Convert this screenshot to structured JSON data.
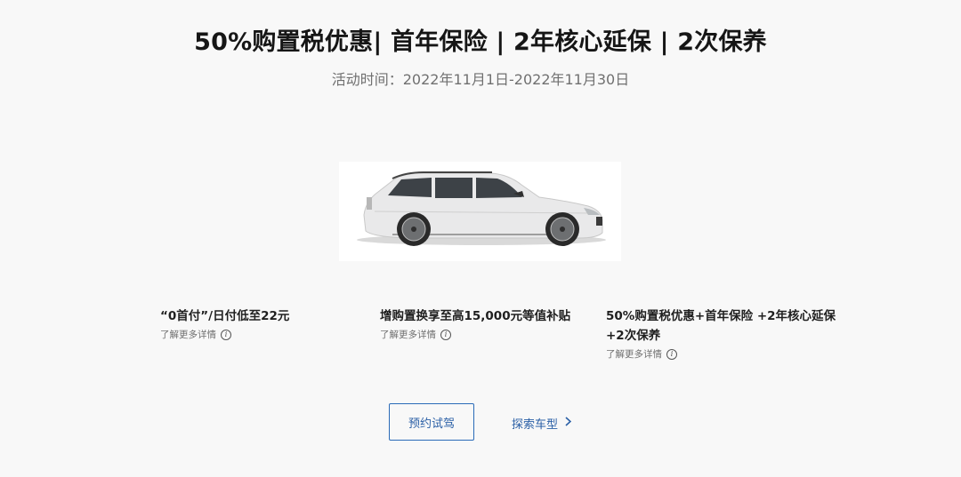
{
  "header": {
    "headline": "50%购置税优惠| 首年保险 | 2年核心延保 | 2次保养",
    "period": "活动时间：2022年11月1日-2022年11月30日"
  },
  "hero": {
    "image": "car-photo"
  },
  "features": [
    {
      "title": "“0首付”/日付低至22元",
      "more": "了解更多详情",
      "icon": "info-icon"
    },
    {
      "title": "增购置换享至高15,000元等值补贴",
      "more": "了解更多详情",
      "icon": "info-icon"
    },
    {
      "title": "50%购置税优惠+首年保险 +2年核心延保 +2次保养",
      "more": "了解更多详情",
      "icon": "info-icon"
    }
  ],
  "actions": {
    "test_drive": "预约试驾",
    "explore": "探索车型",
    "explore_icon": "chevron-right-icon"
  },
  "colors": {
    "accent": "#2a5fa6",
    "background": "#f8f8f8",
    "text": "#1a1a1a",
    "muted": "#707070"
  }
}
